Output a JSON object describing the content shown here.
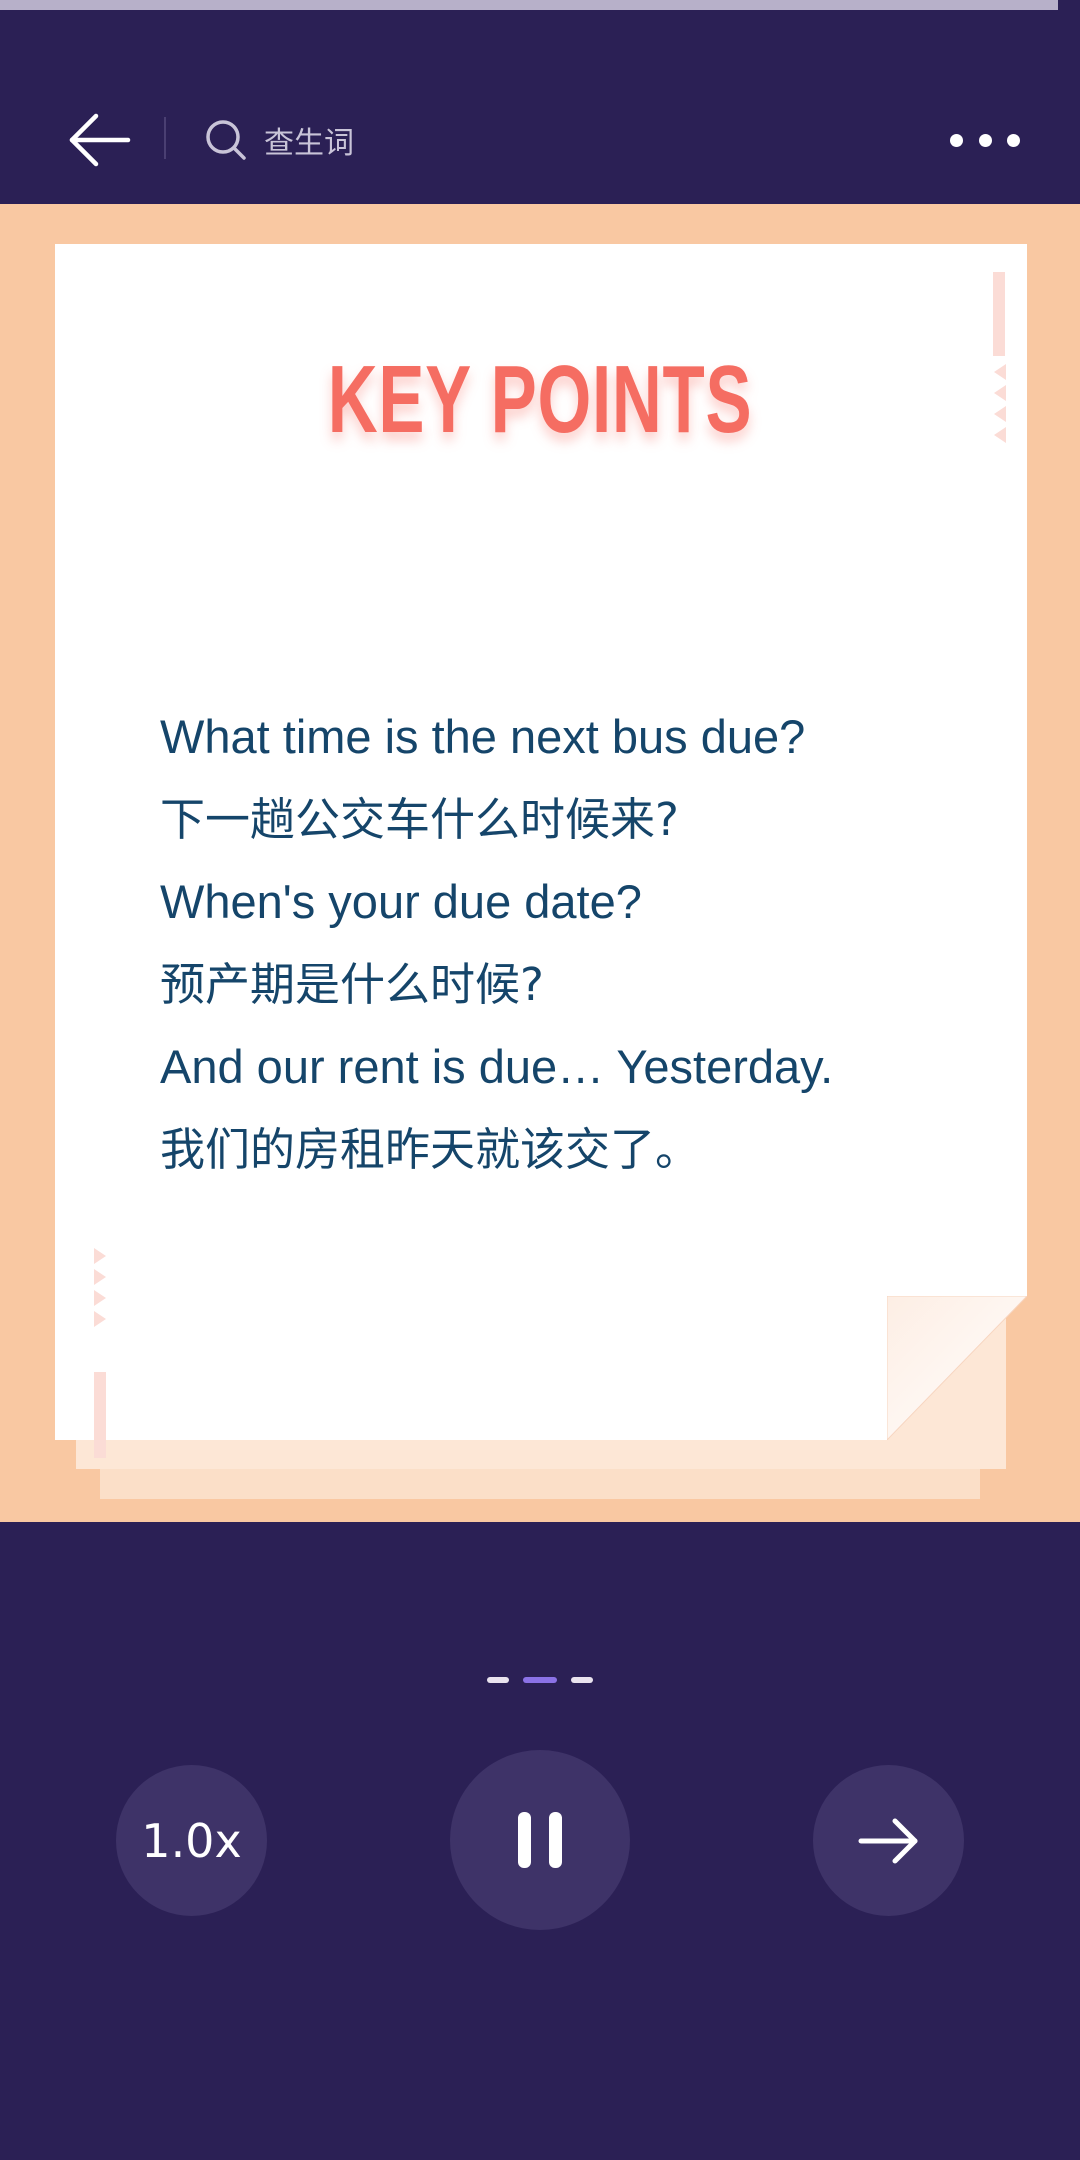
{
  "progress": {
    "fraction": 0.98
  },
  "topbar": {
    "back_icon": "arrow-left-icon",
    "search_icon": "search-icon",
    "search_label": "查生词",
    "more_icon": "more-horizontal-icon"
  },
  "card": {
    "title": "KEY POINTS",
    "lines": [
      "What time is the next bus due?",
      "下一趟公交车什么时候来?",
      "When's your due date?",
      "预产期是什么时候?",
      "And our rent is due… Yesterday.",
      "我们的房租昨天就该交了。"
    ]
  },
  "pager": {
    "count": 3,
    "active_index": 1
  },
  "controls": {
    "speed_label": "1.0x",
    "pause_icon": "pause-icon",
    "next_icon": "arrow-right-icon"
  },
  "colors": {
    "background": "#2b2055",
    "content_bg": "#f9c8a2",
    "title": "#f56d62",
    "text": "#15456a",
    "pager_active": "#8b72e6",
    "control_bg": "#3e3368"
  }
}
